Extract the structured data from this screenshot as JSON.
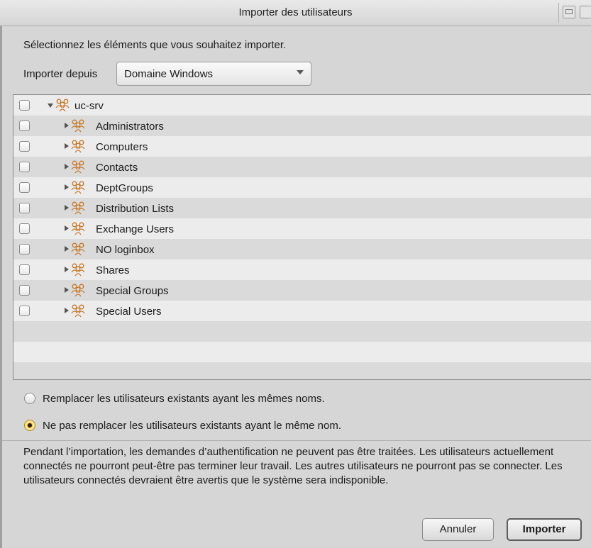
{
  "window": {
    "title": "Importer des utilisateurs"
  },
  "prompt": "Sélectionnez les éléments que vous souhaitez importer.",
  "import_from": {
    "label": "Importer depuis",
    "selected": "Domaine Windows"
  },
  "tree": {
    "root": {
      "label": "uc-srv",
      "expanded": true,
      "checked": false,
      "icon": "group-icon"
    },
    "children": [
      {
        "label": "Administrators",
        "checked": false,
        "icon": "group-icon"
      },
      {
        "label": "Computers",
        "checked": false,
        "icon": "group-icon"
      },
      {
        "label": "Contacts",
        "checked": false,
        "icon": "group-icon"
      },
      {
        "label": "DeptGroups",
        "checked": false,
        "icon": "group-icon"
      },
      {
        "label": "Distribution Lists",
        "checked": false,
        "icon": "group-icon"
      },
      {
        "label": "Exchange Users",
        "checked": false,
        "icon": "group-icon"
      },
      {
        "label": "NO loginbox",
        "checked": false,
        "icon": "group-icon"
      },
      {
        "label": "Shares",
        "checked": false,
        "icon": "group-icon"
      },
      {
        "label": "Special Groups",
        "checked": false,
        "icon": "group-icon"
      },
      {
        "label": "Special Users",
        "checked": false,
        "icon": "group-icon"
      }
    ]
  },
  "options": [
    {
      "label": "Remplacer les utilisateurs existants ayant les mêmes noms.",
      "selected": false
    },
    {
      "label": "Ne pas remplacer les utilisateurs existants ayant le même nom.",
      "selected": true
    }
  ],
  "warning": "Pendant l’importation, les demandes d’authentification ne peuvent pas être traitées. Les utilisateurs actuellement connectés ne pourront peut-être pas terminer leur travail. Les autres utilisateurs ne pourront pas se connecter. Les utilisateurs connectés devraient être avertis que le système sera indisponible.",
  "buttons": {
    "cancel": "Annuler",
    "import": "Importer"
  },
  "colors": {
    "selected_radio": "#f5b400",
    "icon_orange": "#c8782a"
  }
}
